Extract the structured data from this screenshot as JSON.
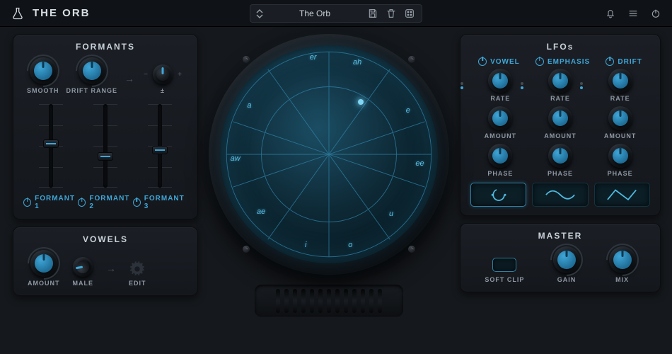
{
  "app": {
    "title": "THE ORB"
  },
  "preset": {
    "name": "The Orb"
  },
  "topbar_icons": {
    "save": "save-icon",
    "delete": "trash-icon",
    "random": "dice-icon",
    "alert": "bell-icon",
    "menu": "menu-icon",
    "power": "power-icon"
  },
  "formants": {
    "title": "FORMANTS",
    "knobs": {
      "smooth": {
        "label": "SMOOTH",
        "value": 0.5
      },
      "drift_range": {
        "label": "DRIFT RANGE",
        "value": 0.5
      },
      "plus_minus": {
        "label": "±",
        "value": 0.5
      }
    },
    "sliders": [
      {
        "value": 0.58
      },
      {
        "value": 0.42
      },
      {
        "value": 0.5
      }
    ],
    "toggles": [
      {
        "label": "FORMANT 1",
        "on": true
      },
      {
        "label": "FORMANT 2",
        "on": true
      },
      {
        "label": "FORMANT 3",
        "on": true
      }
    ]
  },
  "vowels": {
    "title": "VOWELS",
    "amount": {
      "label": "AMOUNT",
      "value": 0.5
    },
    "voice": {
      "label": "MALE",
      "value": 0.2
    },
    "edit": {
      "label": "EDIT"
    }
  },
  "orb": {
    "labels": [
      "er",
      "ah",
      "e",
      "ee",
      "u",
      "o",
      "i",
      "ae",
      "aw",
      "a"
    ],
    "cursor": {
      "angle_deg": 60,
      "radius": 0.55
    }
  },
  "lfos": {
    "title": "LFOs",
    "columns": [
      {
        "name": "VOWEL",
        "on": true,
        "rate": 0.5,
        "amount": 0.5,
        "phase": 0.5,
        "wave": "random"
      },
      {
        "name": "EMPHASIS",
        "on": true,
        "rate": 0.5,
        "amount": 0.5,
        "phase": 0.5,
        "wave": "sine"
      },
      {
        "name": "DRIFT",
        "on": true,
        "rate": 0.5,
        "amount": 0.5,
        "phase": 0.5,
        "wave": "triangle"
      }
    ],
    "row_labels": {
      "rate": "RATE",
      "amount": "AMOUNT",
      "phase": "PHASE"
    }
  },
  "master": {
    "title": "MASTER",
    "softclip": {
      "label": "SOFT CLIP",
      "on": true
    },
    "gain": {
      "label": "GAIN",
      "value": 0.55
    },
    "mix": {
      "label": "MIX",
      "value": 0.55
    }
  }
}
